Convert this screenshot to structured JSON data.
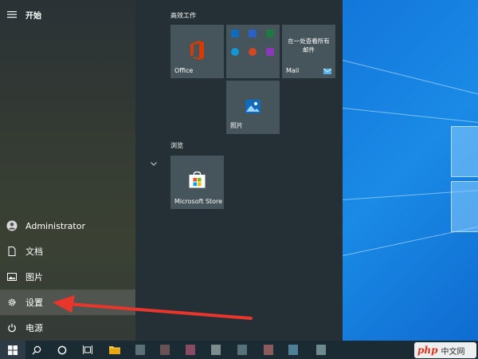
{
  "start": {
    "title": "开始",
    "user": "Administrator",
    "documents": "文档",
    "pictures": "图片",
    "settings": "设置",
    "power": "电源"
  },
  "groups": {
    "productivity": "高效工作",
    "browse": "浏览"
  },
  "tiles": {
    "office": "Office",
    "office_apps": [
      "outlook-icon",
      "word-icon",
      "excel-icon",
      "skype-icon",
      "powerpoint-icon",
      "onenote-icon"
    ],
    "mail_heading": "在一处查看所有邮件",
    "mail": "Mail",
    "photos": "照片",
    "store": "Microsoft Store"
  },
  "watermark": {
    "php": "php",
    "cn": "中文网"
  },
  "colors": {
    "annotation_arrow": "#e8362c",
    "office_logo": "#d83b01",
    "desktop_blue": "#1479dc"
  }
}
